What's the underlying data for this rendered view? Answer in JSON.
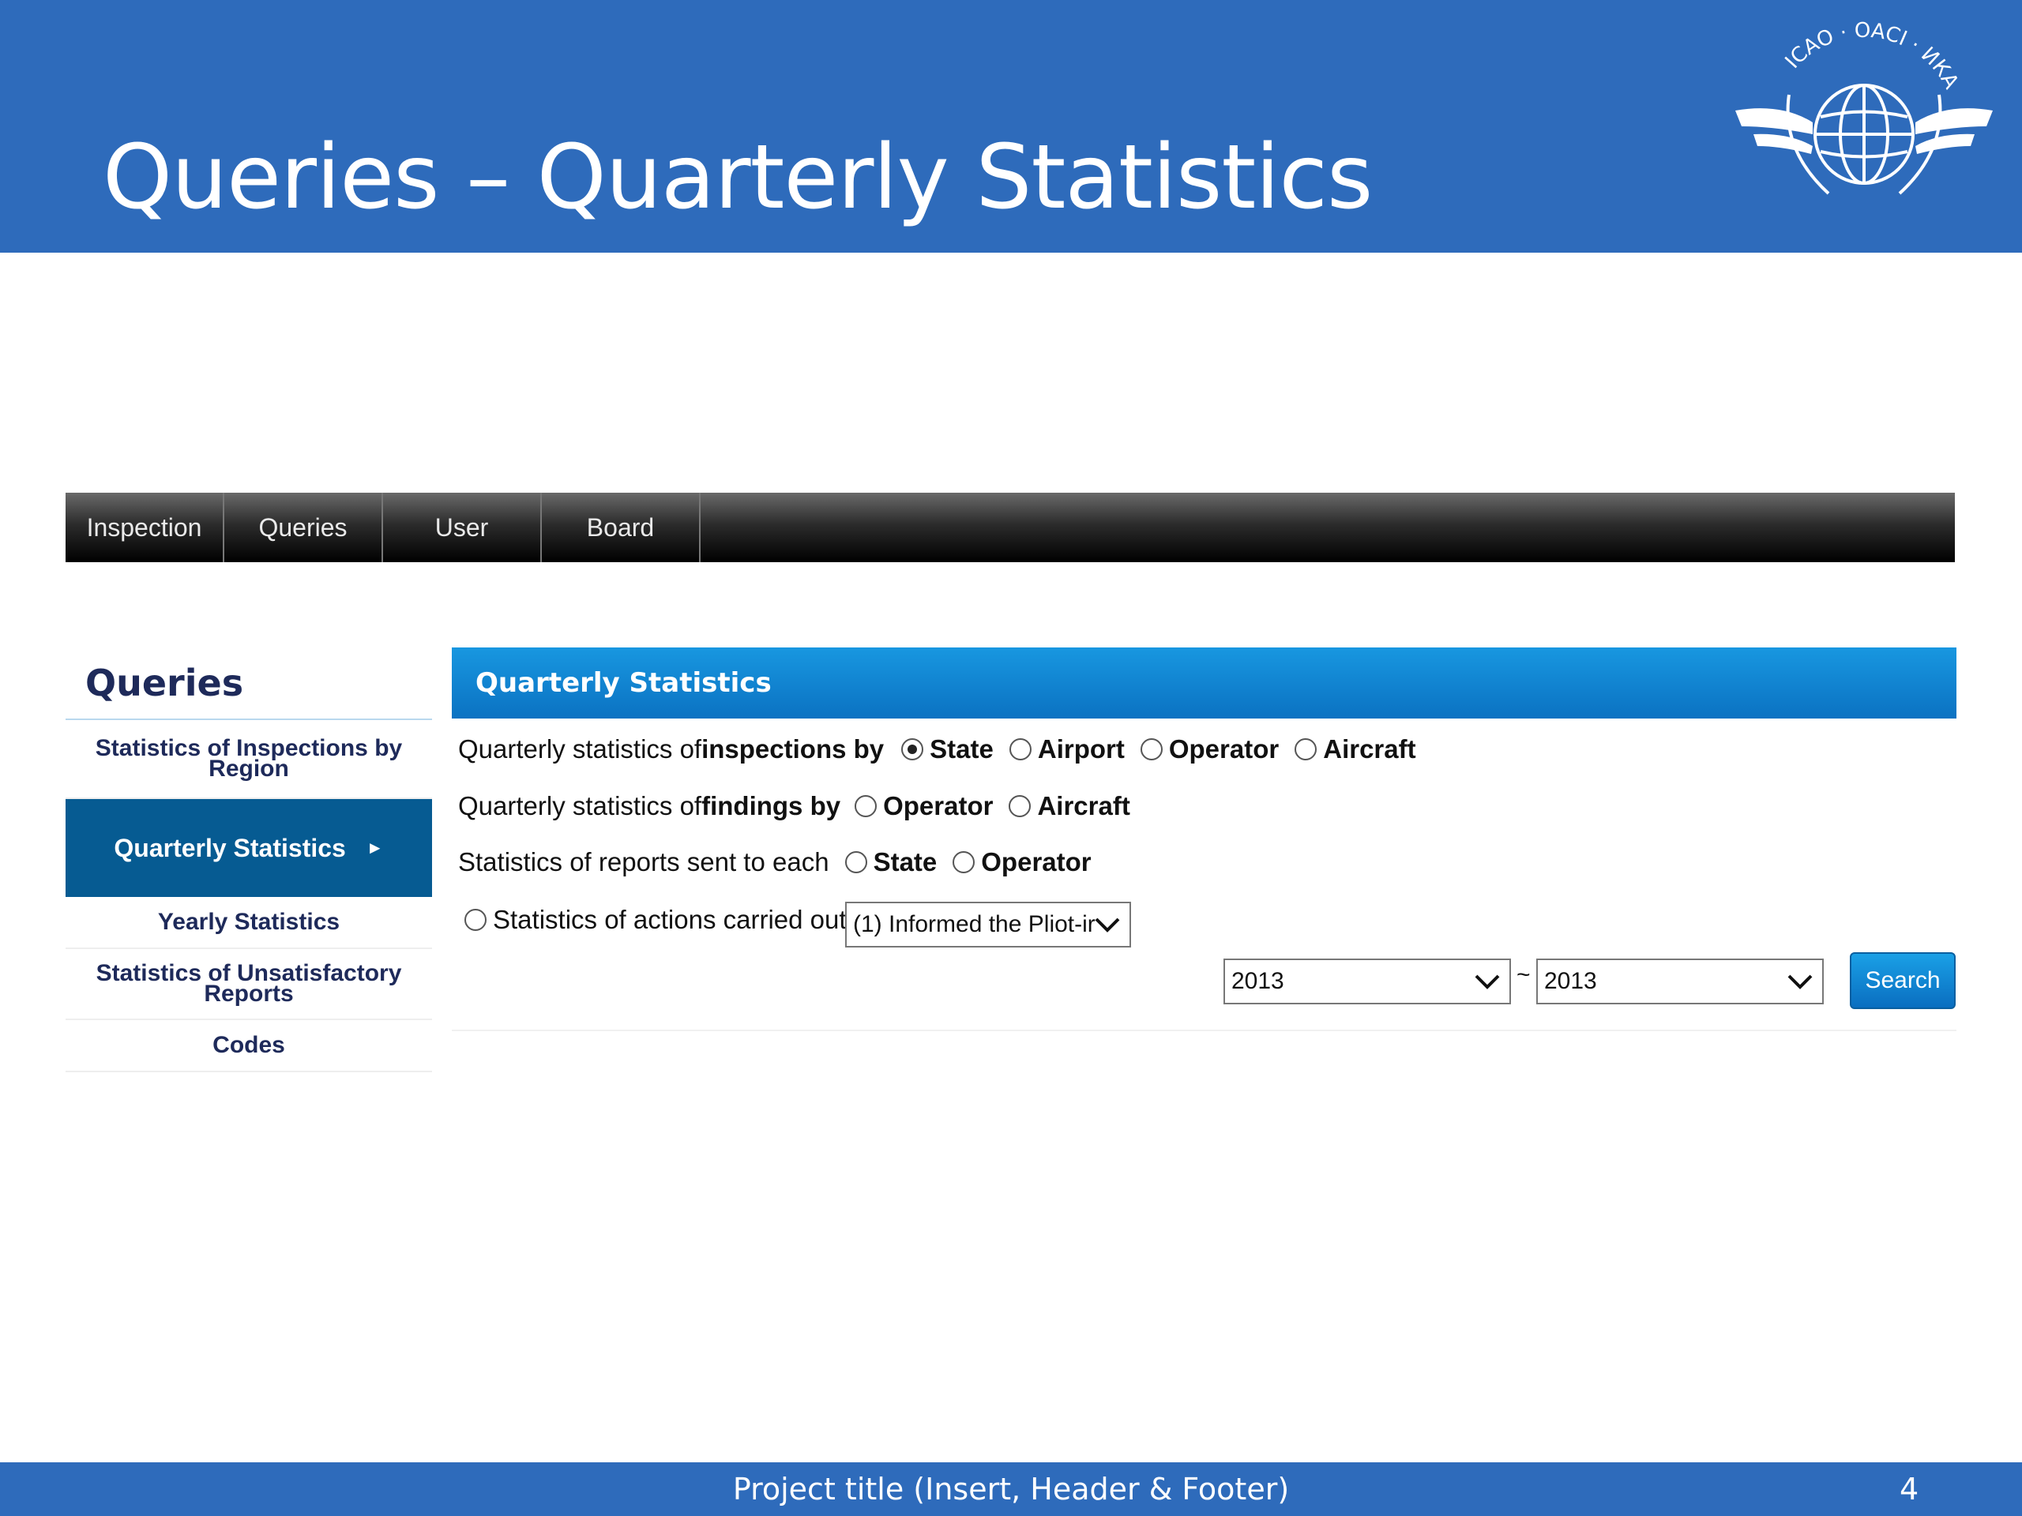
{
  "slide": {
    "title": "Queries – Quarterly Statistics",
    "logo_text": "ICAO · OACI · ИКАО"
  },
  "nav": {
    "items": [
      "Inspection",
      "Queries",
      "User",
      "Board"
    ]
  },
  "sidebar": {
    "title": "Queries",
    "items": [
      "Statistics of Inspections by Region",
      "Quarterly Statistics",
      "Yearly Statistics",
      "Statistics of Unsatisfactory Reports",
      "Codes"
    ],
    "active_arrow": "►"
  },
  "panel": {
    "header": "Quarterly Statistics",
    "row1": {
      "prefix": "Quarterly statistics of ",
      "bold": "inspections by",
      "options": [
        "State",
        "Airport",
        "Operator",
        "Aircraft"
      ],
      "selected": "State"
    },
    "row2": {
      "prefix": "Quarterly statistics of ",
      "bold": "findings by",
      "options": [
        "Operator",
        "Aircraft"
      ]
    },
    "row3": {
      "prefix": "Statistics of reports sent to each",
      "options": [
        "State",
        "Operator"
      ]
    },
    "row4": {
      "label": "Statistics of actions carried out",
      "select_value": "(1) Informed the Pliot-ir"
    },
    "year_from": "2013",
    "year_to": "2013",
    "separator": "~",
    "search_label": "Search"
  },
  "footer": {
    "text": "Project title (Insert, Header & Footer)",
    "page": "4"
  },
  "colors": {
    "brand_blue": "#2e6bbb",
    "panel_header": "#0b72c2",
    "active_item": "#065b92",
    "sidebar_text": "#1e2a5a"
  }
}
